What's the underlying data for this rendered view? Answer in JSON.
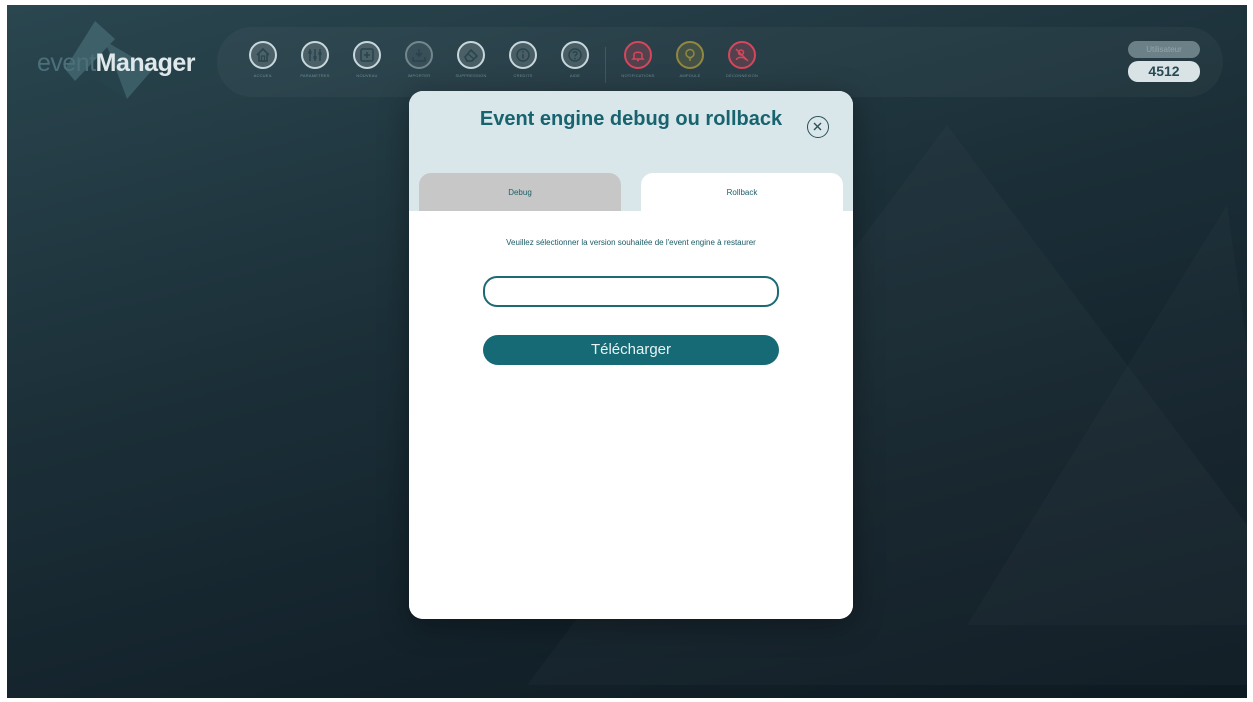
{
  "app": {
    "logo_part1": "event",
    "logo_part2": "Manager"
  },
  "toolbar": {
    "items": [
      {
        "label": "ACCUEIL",
        "icon": "home-icon"
      },
      {
        "label": "PARAMETRES",
        "icon": "sliders-icon"
      },
      {
        "label": "NOUVEAU",
        "icon": "plus-square-icon"
      },
      {
        "label": "IMPORTER",
        "icon": "import-icon"
      },
      {
        "label": "SUPPRESSION",
        "icon": "eraser-icon"
      },
      {
        "label": "CREDITS",
        "icon": "info-icon"
      },
      {
        "label": "AIDE",
        "icon": "help-icon"
      },
      {
        "label": "NOTIFICATIONS",
        "icon": "bell-icon"
      },
      {
        "label": "AMPOULE",
        "icon": "lightbulb-icon"
      },
      {
        "label": "DÉCONNEXION",
        "icon": "user-off-icon"
      }
    ]
  },
  "user": {
    "name": "Utilisateur",
    "count": "4512"
  },
  "modal": {
    "title": "Event engine debug ou rollback",
    "tabs": [
      {
        "label": "Debug",
        "active": false
      },
      {
        "label": "Rollback",
        "active": true
      }
    ],
    "instruction": "Veuillez sélectionner la version souhaitée de l'event engine à restaurer",
    "version_input": {
      "value": "",
      "placeholder": ""
    },
    "download_button": "Télécharger"
  },
  "colors": {
    "accent": "#156a75",
    "title": "#17646f",
    "header_bg": "#d9e7eb",
    "inactive_tab": "#c7c7c7",
    "alert_red": "#d4475c",
    "warning_yellow": "#d7b73c"
  }
}
